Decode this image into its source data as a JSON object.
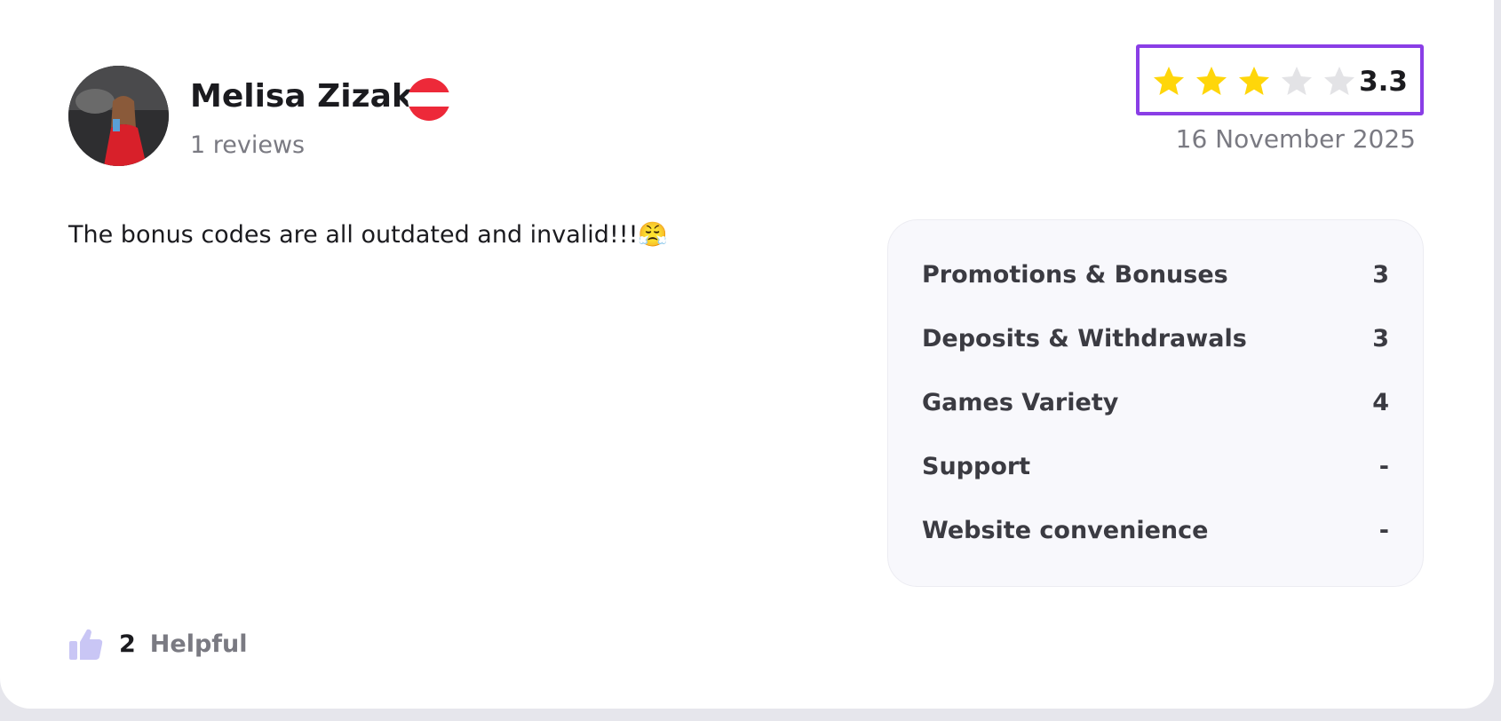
{
  "review": {
    "author": {
      "name": "Melisa Zizak",
      "review_count": "1 reviews",
      "avatar": "avatar-photo",
      "flag": "austria-flag-icon"
    },
    "rating": {
      "value": "3.3",
      "stars_filled": 3,
      "stars_total": 5,
      "star_color": "#ffd60a",
      "star_empty_color": "#e3e3e6",
      "highlight_border_color": "#8a3ee6"
    },
    "date": "16 November 2025",
    "text": "The bonus codes are all outdated and invalid!!!😤",
    "scores": [
      {
        "label": "Promotions & Bonuses",
        "value": "3"
      },
      {
        "label": "Deposits & Withdrawals",
        "value": "3"
      },
      {
        "label": "Games Variety",
        "value": "4"
      },
      {
        "label": "Support",
        "value": "-"
      },
      {
        "label": "Website convenience",
        "value": "-"
      }
    ],
    "helpful": {
      "count": "2",
      "label": "Helpful",
      "icon": "thumbs-up-icon",
      "icon_color": "#c9c6f5"
    }
  }
}
